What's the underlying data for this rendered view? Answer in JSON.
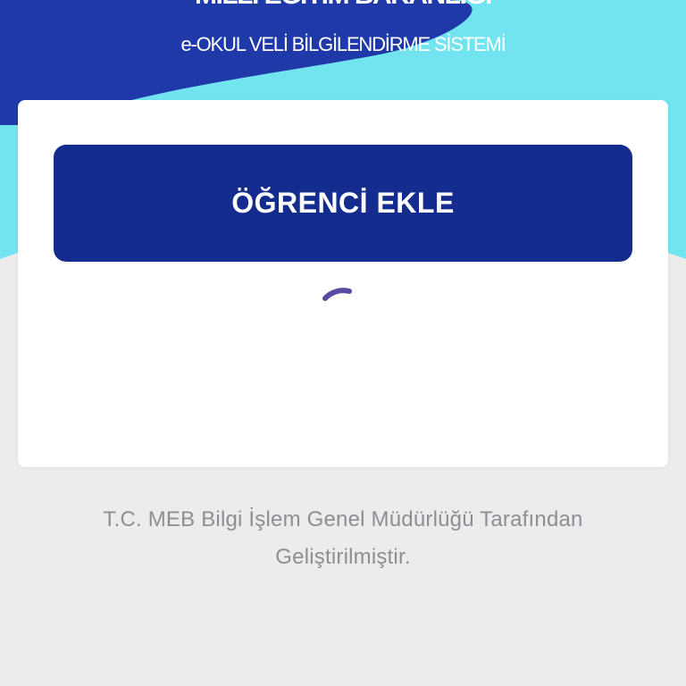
{
  "header": {
    "ministry_title": "MİLLÎ EĞİTİM BAKANLIĞI",
    "system_title": "e-OKUL VELİ BİLGİLENDİRME SİSTEMİ"
  },
  "card": {
    "add_student_label": "ÖĞRENCİ EKLE",
    "loading_icon": "loading-spinner-icon"
  },
  "footer": {
    "credit_text": "T.C. MEB Bilgi İşlem Genel Müdürlüğü Tarafından Geliştirilmiştir."
  },
  "colors": {
    "header_cyan": "#71e4ef",
    "header_blue": "#2039a9",
    "button_blue": "#142c8e",
    "spinner_purple": "#5a4aa4",
    "page_background": "#ececec"
  }
}
